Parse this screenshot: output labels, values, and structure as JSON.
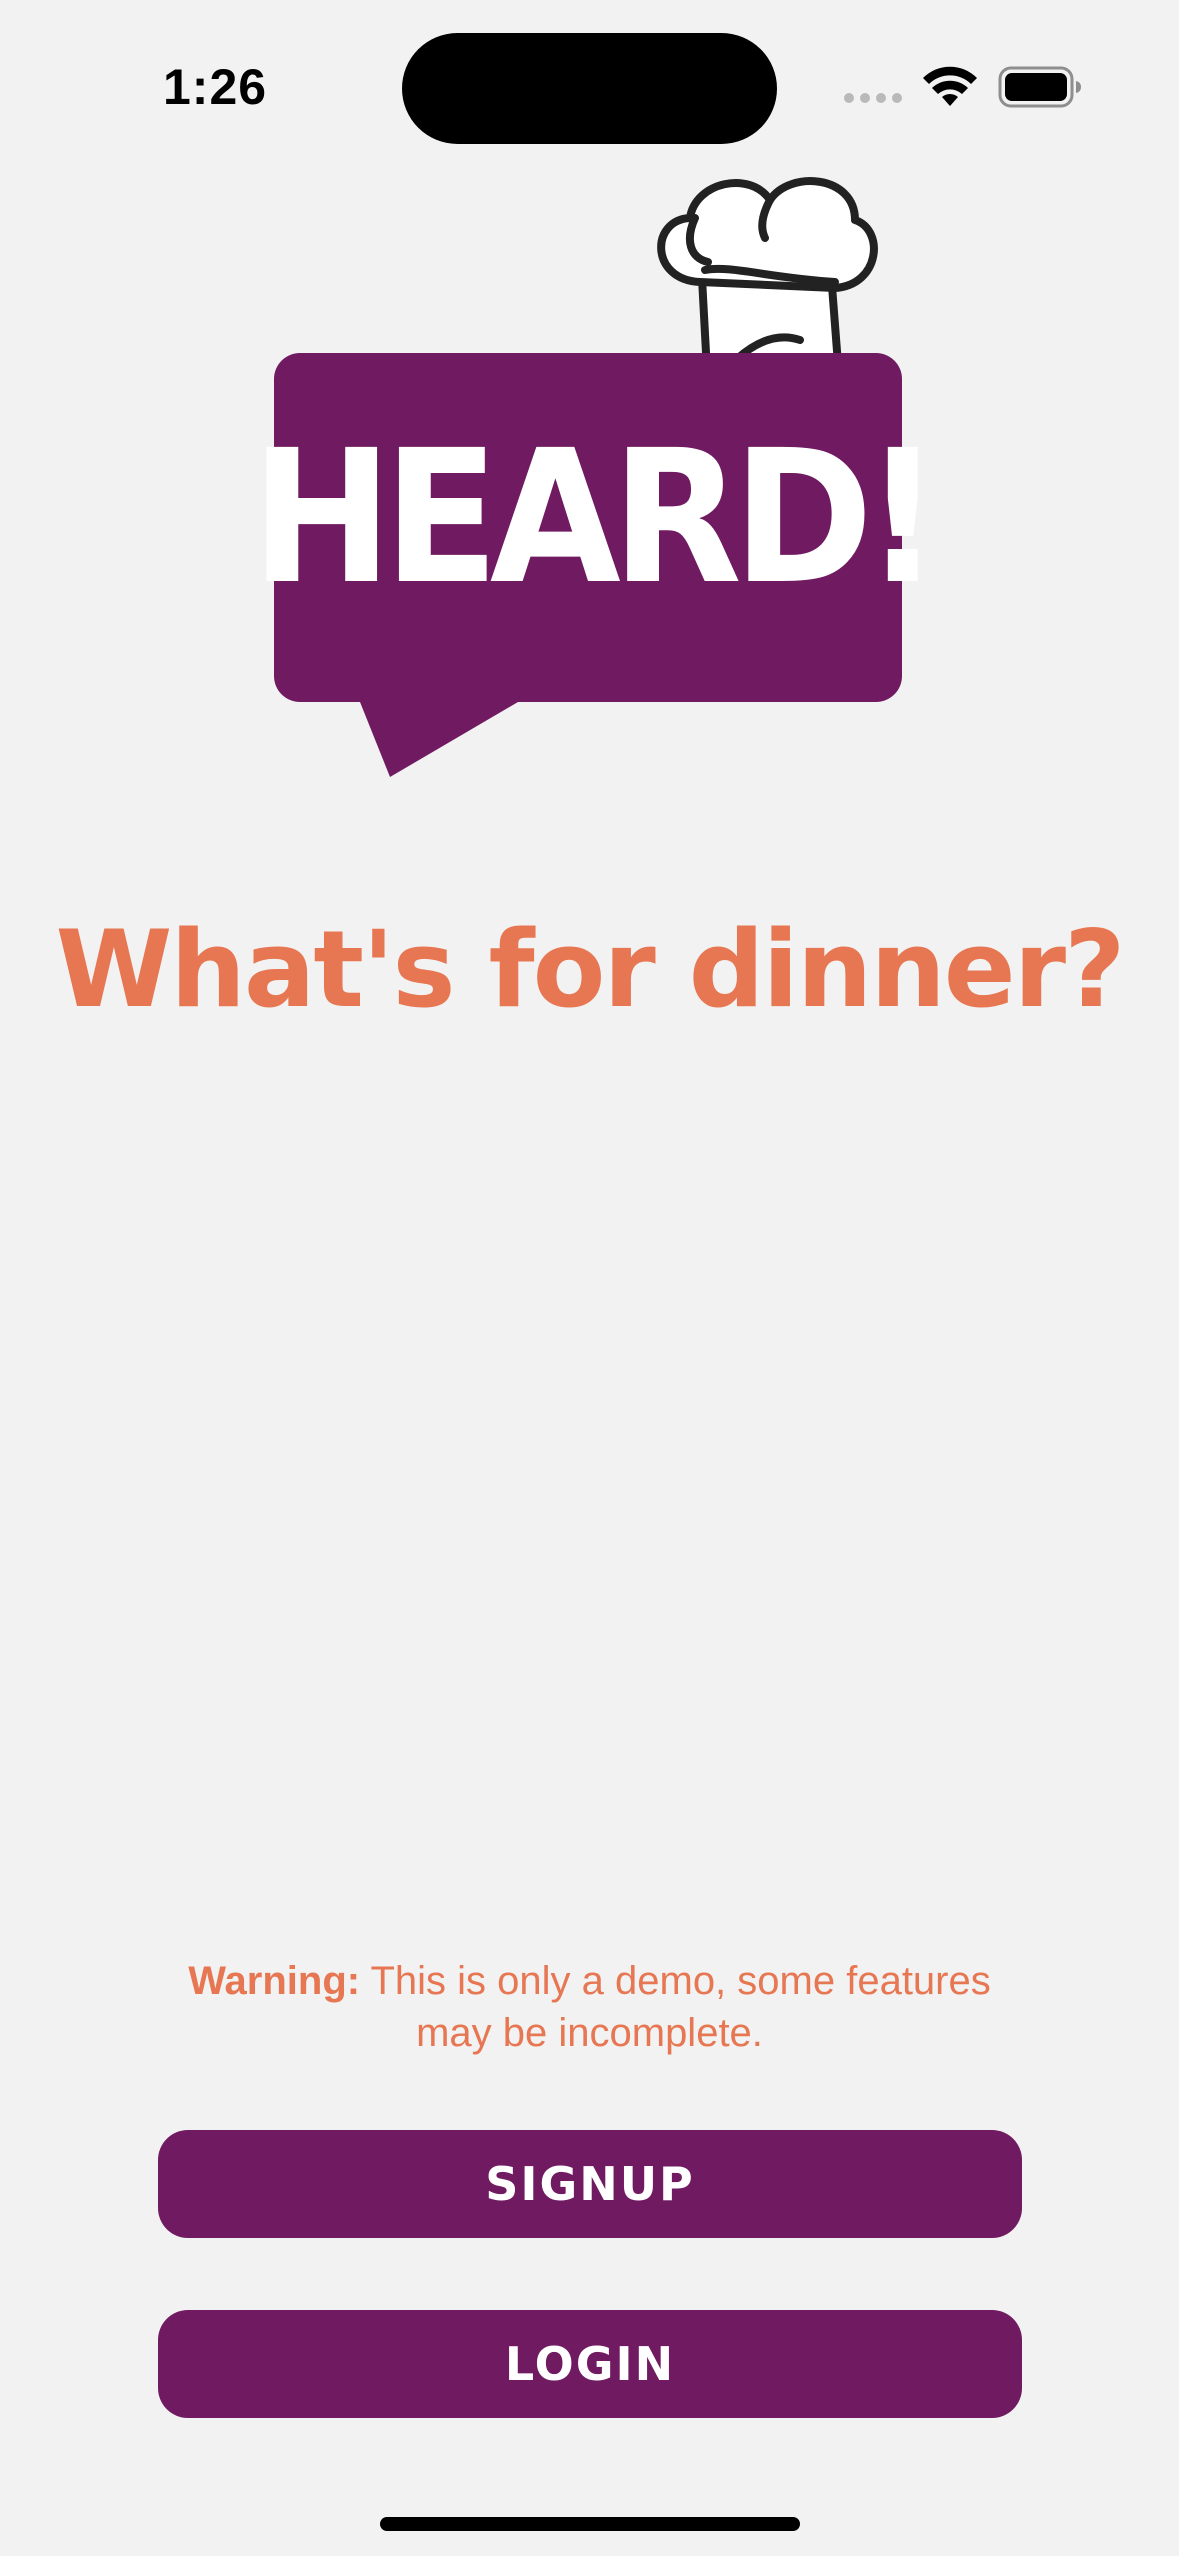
{
  "status_bar": {
    "time": "1:26"
  },
  "logo": {
    "text": "HEARD!",
    "bubble_color": "#701a61",
    "icon": "chef-hat-icon"
  },
  "tagline": "What's for dinner?",
  "warning": {
    "label": "Warning:",
    "message": "This is only a demo, some features may be incomplete."
  },
  "buttons": {
    "signup": "SIGNUP",
    "login": "LOGIN"
  },
  "colors": {
    "background": "#f2f2f2",
    "accent": "#e77752",
    "primary": "#701a61",
    "button_text": "#ffffff"
  }
}
